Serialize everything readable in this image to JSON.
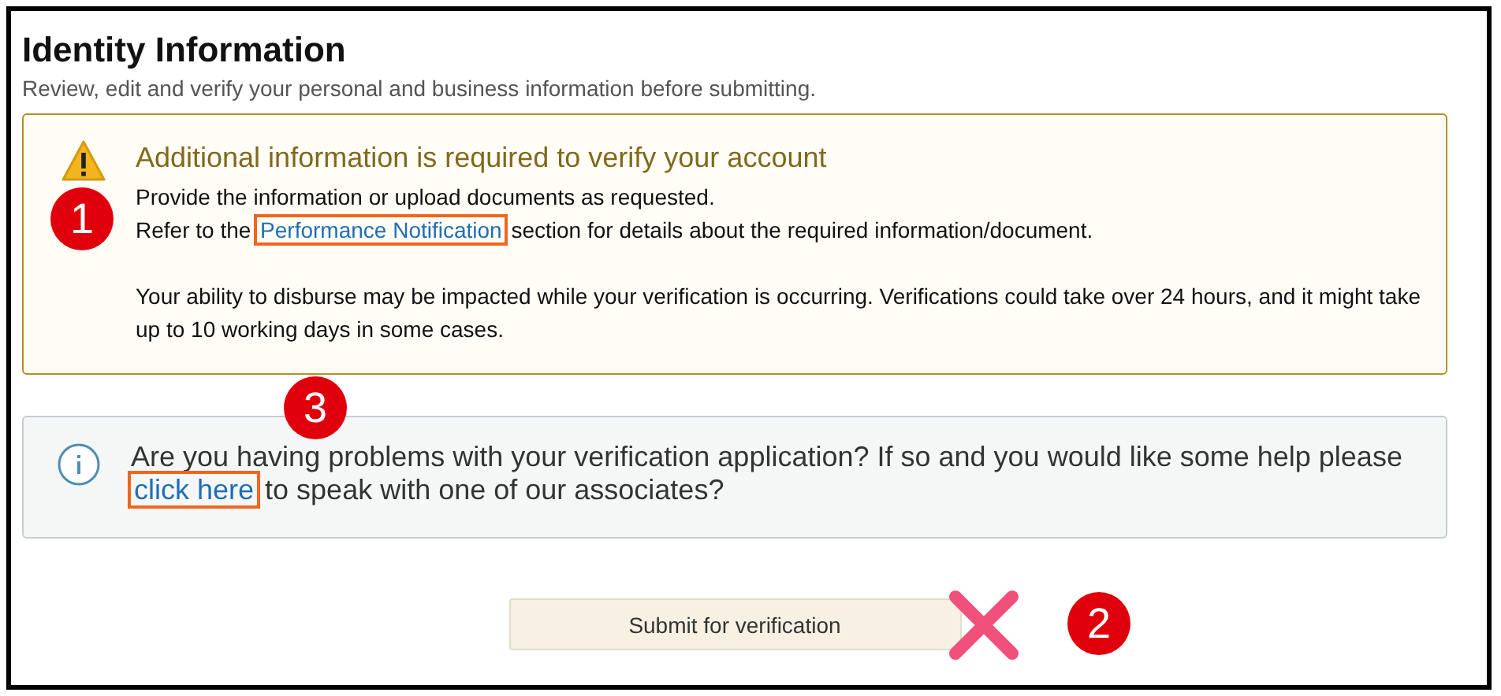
{
  "page": {
    "title": "Identity Information",
    "subtitle": "Review, edit and verify your personal and business information before submitting."
  },
  "alert": {
    "marker": "1",
    "heading": "Additional information is required to verify your account",
    "line": "Provide the information or upload documents as requested.",
    "reference": {
      "before": "Refer to the",
      "link": {
        "text": "Performance Notification",
        "highlighted": true
      },
      "after": "section for details about the required information/document."
    },
    "note": "Your ability to disburse may be impacted while your verification is occurring. Verifications could take over 24 hours, and it might take up to 10 working days in some cases."
  },
  "help": {
    "marker": "3",
    "before": "Are you having problems with your verification application? If so and you would like some help please",
    "link": {
      "text": "click here",
      "highlighted": true
    },
    "after": "to speak with one of our associates?"
  },
  "submit": {
    "label": "Submit for verification",
    "crossed_out": true,
    "marker": "2"
  }
}
